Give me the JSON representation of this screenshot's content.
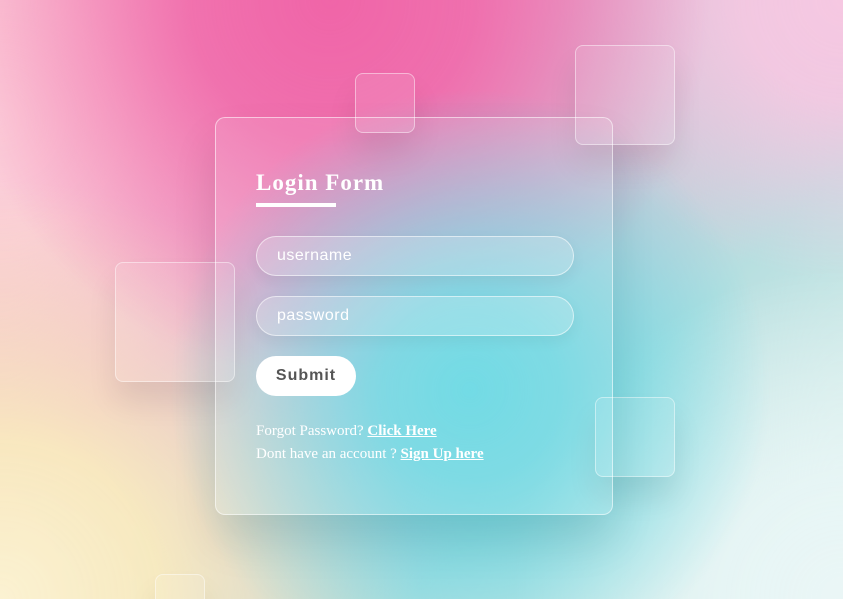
{
  "form": {
    "title": "Login Form",
    "username_placeholder": "username",
    "password_placeholder": "password",
    "username_value": "",
    "password_value": "",
    "submit_label": "Submit"
  },
  "links": {
    "forgot_text": "Forgot Password? ",
    "forgot_link": "Click Here",
    "signup_text": "Dont have an account ? ",
    "signup_link": "Sign Up here"
  },
  "colors": {
    "text": "#ffffff",
    "button_text": "#555555",
    "accent_pink": "#f065a8",
    "accent_cyan": "#5fd6e2"
  }
}
